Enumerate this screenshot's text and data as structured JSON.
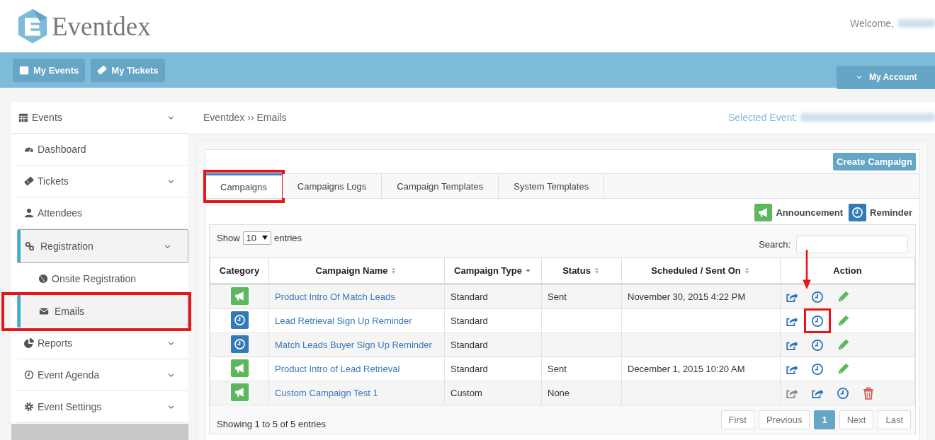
{
  "header": {
    "logo": "Eventdex",
    "welcome": "Welcome,"
  },
  "nav": {
    "buttons": [
      {
        "label": "My Events"
      },
      {
        "label": "My Tickets"
      }
    ],
    "account": "My Account"
  },
  "sidebar": {
    "header": {
      "label": "Events"
    },
    "items": [
      {
        "label": "Dashboard",
        "collapsible": false,
        "selected": false
      },
      {
        "label": "Tickets",
        "collapsible": true,
        "selected": false
      },
      {
        "label": "Attendees",
        "collapsible": false,
        "selected": false
      },
      {
        "label": "Registration",
        "collapsible": true,
        "selected": true,
        "children": [
          {
            "label": "Onsite Registration",
            "selected": false,
            "highlighted": false
          },
          {
            "label": "Emails",
            "selected": true,
            "highlighted": true
          }
        ]
      },
      {
        "label": "Reports",
        "collapsible": true,
        "selected": false
      },
      {
        "label": "Event Agenda",
        "collapsible": true,
        "selected": false
      },
      {
        "label": "Event Settings",
        "collapsible": true,
        "selected": false
      }
    ]
  },
  "breadcrumb": "Eventdex ›› Emails",
  "selected_event_label": "Selected Event:",
  "create_button": "Create Campaign",
  "tabs": [
    {
      "label": "Campaigns",
      "selected": true,
      "highlighted": true
    },
    {
      "label": "Campaigns Logs",
      "selected": false,
      "highlighted": false
    },
    {
      "label": "Campaign Templates",
      "selected": false,
      "highlighted": false
    },
    {
      "label": "System Templates",
      "selected": false,
      "highlighted": false
    }
  ],
  "legend": [
    {
      "kind": "announcement",
      "label": "Announcement"
    },
    {
      "kind": "reminder",
      "label": "Reminder"
    }
  ],
  "table": {
    "show_label": "Show",
    "page_size": "10",
    "entries_label": "entries",
    "search_label": "Search:",
    "columns": [
      {
        "label": "Category",
        "sortable": false
      },
      {
        "label": "Campaign Name",
        "sortable": true,
        "sorted": false
      },
      {
        "label": "Campaign Type",
        "sortable": true,
        "sorted": true
      },
      {
        "label": "Status",
        "sortable": true,
        "sorted": false
      },
      {
        "label": "Scheduled / Sent On",
        "sortable": true,
        "sorted": false
      },
      {
        "label": "Action",
        "sortable": false
      }
    ],
    "rows": [
      {
        "kind": "announcement",
        "name": "Product Intro Of Match Leads",
        "type": "Standard",
        "status": "Sent",
        "sent_on": "November 30, 2015 4:22 PM",
        "actions": [
          {
            "kind": "share",
            "highlighted": false,
            "pointer": false
          },
          {
            "kind": "schedule",
            "highlighted": false,
            "pointer": true
          },
          {
            "kind": "edit",
            "highlighted": false,
            "pointer": false
          }
        ]
      },
      {
        "kind": "reminder",
        "name": "Lead Retrieval Sign Up Reminder",
        "type": "Standard",
        "status": "",
        "sent_on": "",
        "actions": [
          {
            "kind": "share",
            "highlighted": false,
            "pointer": false
          },
          {
            "kind": "schedule",
            "highlighted": true,
            "pointer": false
          },
          {
            "kind": "edit",
            "highlighted": false,
            "pointer": false
          }
        ]
      },
      {
        "kind": "reminder",
        "name": "Match Leads Buyer Sign Up Reminder",
        "type": "Standard",
        "status": "",
        "sent_on": "",
        "actions": [
          {
            "kind": "share",
            "highlighted": false,
            "pointer": false
          },
          {
            "kind": "schedule",
            "highlighted": false,
            "pointer": false
          },
          {
            "kind": "edit",
            "highlighted": false,
            "pointer": false
          }
        ]
      },
      {
        "kind": "announcement",
        "name": "Product Intro of Lead Retrieval",
        "type": "Standard",
        "status": "Sent",
        "sent_on": "December 1, 2015 10:20 AM",
        "actions": [
          {
            "kind": "share",
            "highlighted": false,
            "pointer": false
          },
          {
            "kind": "schedule",
            "highlighted": false,
            "pointer": false
          },
          {
            "kind": "edit",
            "highlighted": false,
            "pointer": false
          }
        ]
      },
      {
        "kind": "announcement",
        "name": "Custom Campaign Test 1",
        "type": "Custom",
        "status": "None",
        "sent_on": "",
        "actions": [
          {
            "kind": "share-disabled",
            "highlighted": false,
            "pointer": false
          },
          {
            "kind": "share",
            "highlighted": false,
            "pointer": false
          },
          {
            "kind": "schedule",
            "highlighted": false,
            "pointer": false
          },
          {
            "kind": "delete",
            "highlighted": false,
            "pointer": false
          }
        ]
      }
    ],
    "info": "Showing 1 to 5 of 5 entries",
    "pages": [
      {
        "label": "First",
        "selected": false
      },
      {
        "label": "Previous",
        "selected": false
      },
      {
        "label": "1",
        "selected": true
      },
      {
        "label": "Next",
        "selected": false
      },
      {
        "label": "Last",
        "selected": false
      }
    ]
  }
}
